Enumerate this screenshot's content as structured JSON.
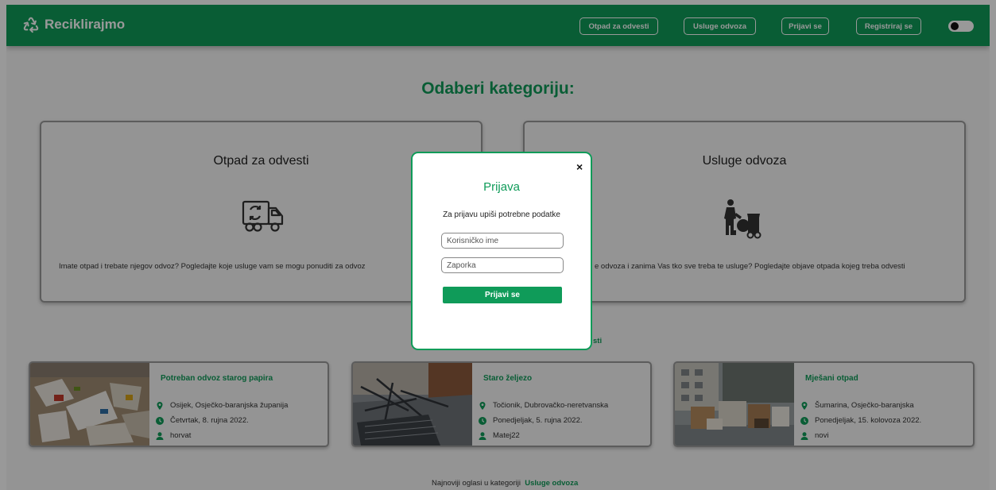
{
  "nav": {
    "brand": "Reciklirajmo",
    "buttons": [
      "Otpad za odvesti",
      "Usluge odvoza",
      "Prijavi se",
      "Registriraj se"
    ]
  },
  "main": {
    "heading": "Odaberi kategoriju:",
    "categories": [
      {
        "title": "Otpad za odvesti",
        "icon": "recycling-truck-icon",
        "description": "Imate otpad i trebate njegov odvoz? Pogledajte koje usluge vam se mogu ponuditi za odvoz"
      },
      {
        "title": "Usluge odvoza",
        "icon": "garbage-collector-icon",
        "description": "e odvoza i zanima Vas tko sve treba te usluge? Pogledajte objave otpada kojeg treba odvesti"
      }
    ],
    "section1_fragment": "sti",
    "listings": [
      {
        "title": "Potreban odvoz starog papira",
        "location": "Osijek, Osječko-baranjska županija",
        "date": "Četvrtak, 8. rujna 2022.",
        "user": "horvat"
      },
      {
        "title": "Staro željezo",
        "location": "Točionik, Dubrovačko-neretvanska",
        "date": "Ponedjeljak, 5. rujna 2022.",
        "user": "Matej22"
      },
      {
        "title": "Mješani otpad",
        "location": "Šumarina, Osječko-baranjska",
        "date": "Ponedjeljak, 15. kolovoza 2022.",
        "user": "novi"
      }
    ],
    "section2": {
      "prefix": "Najnoviji oglasi u kategoriji",
      "accent": "Usluge odvoza"
    }
  },
  "modal": {
    "close": "×",
    "title": "Prijava",
    "subtitle": "Za prijavu upiši potrebne podatke",
    "username_placeholder": "Korisničko ime",
    "password_placeholder": "Zaporka",
    "submit": "Prijavi se"
  },
  "colors": {
    "brand": "#0f9b59",
    "overlay": "rgba(0,0,0,0.4)"
  }
}
